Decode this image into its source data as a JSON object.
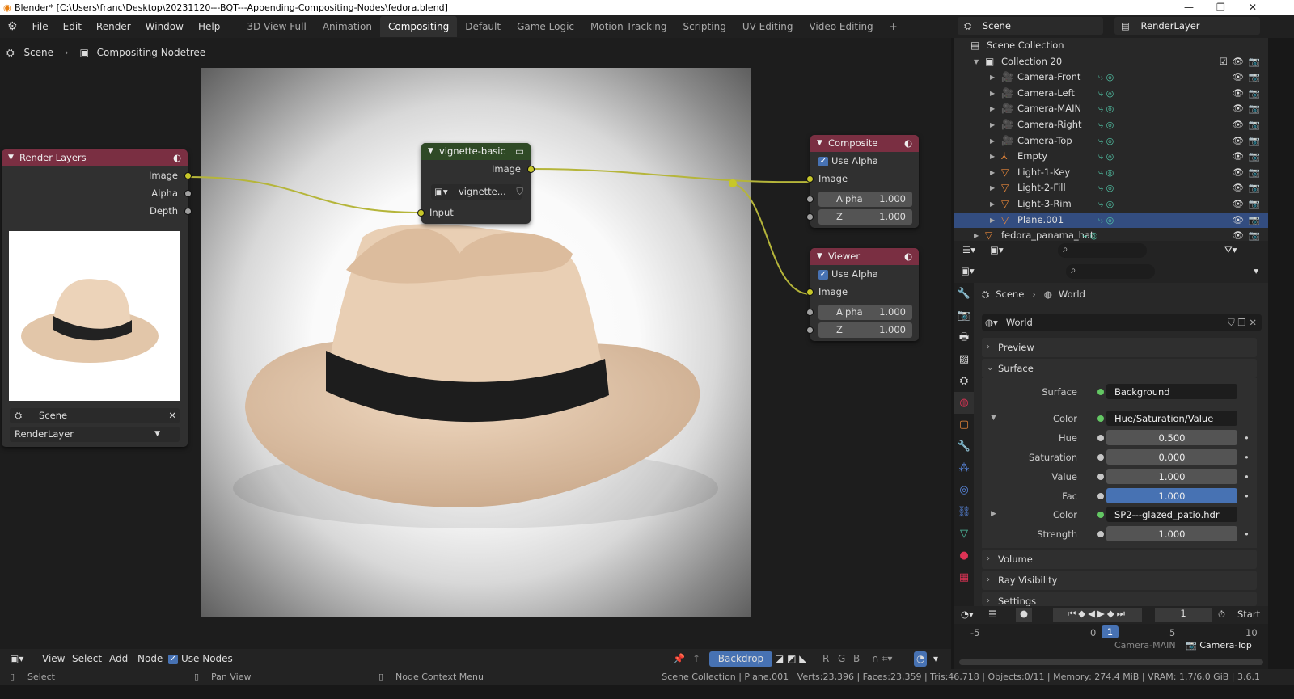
{
  "title": "Blender* [C:\\Users\\franc\\Desktop\\20231120---BQT---Appending-Compositing-Nodes\\fedora.blend]",
  "menu": [
    "File",
    "Edit",
    "Render",
    "Window",
    "Help"
  ],
  "workspaces": [
    "3D View Full",
    "Animation",
    "Compositing",
    "Default",
    "Game Logic",
    "Motion Tracking",
    "Scripting",
    "UV Editing",
    "Video Editing",
    "+"
  ],
  "active_workspace": "Compositing",
  "top_right": {
    "scene": "Scene",
    "view_layer": "RenderLayer"
  },
  "breadcrumb": {
    "scene": "Scene",
    "tree": "Compositing Nodetree"
  },
  "nodes": {
    "render_layers": {
      "title": "Render Layers",
      "outputs": [
        "Image",
        "Alpha",
        "Depth"
      ],
      "scene": "Scene",
      "layer": "RenderLayer",
      "color": "#7a2f42"
    },
    "vignette": {
      "title": "vignette-basic",
      "output": "Image",
      "group": "vignette...",
      "input": "Input",
      "color": "#2f4a26"
    },
    "composite": {
      "title": "Composite",
      "use_alpha": "Use Alpha",
      "image": "Image",
      "alpha_label": "Alpha",
      "alpha": "1.000",
      "z_label": "Z",
      "z": "1.000",
      "color": "#7a2f42"
    },
    "viewer": {
      "title": "Viewer",
      "use_alpha": "Use Alpha",
      "image": "Image",
      "alpha_label": "Alpha",
      "alpha": "1.000",
      "z_label": "Z",
      "z": "1.000",
      "color": "#7a2f42"
    }
  },
  "outliner": {
    "root": "Scene Collection",
    "items": [
      {
        "name": "Collection 20",
        "type": "collection"
      },
      {
        "name": "Camera-Front",
        "type": "camera"
      },
      {
        "name": "Camera-Left",
        "type": "camera"
      },
      {
        "name": "Camera-MAIN",
        "type": "camera"
      },
      {
        "name": "Camera-Right",
        "type": "camera"
      },
      {
        "name": "Camera-Top",
        "type": "camera"
      },
      {
        "name": "Empty",
        "type": "empty"
      },
      {
        "name": "Light-1-Key",
        "type": "light"
      },
      {
        "name": "Light-2-Fill",
        "type": "light"
      },
      {
        "name": "Light-3-Rim",
        "type": "light"
      },
      {
        "name": "Plane.001",
        "type": "mesh",
        "selected": true
      },
      {
        "name": "fedora_panama_hat",
        "type": "mesh"
      }
    ]
  },
  "properties": {
    "breadcrumb": {
      "scene": "Scene",
      "world": "World"
    },
    "world_name": "World",
    "sections": {
      "preview": "Preview",
      "surface": "Surface",
      "volume": "Volume",
      "ray": "Ray Visibility",
      "settings": "Settings"
    },
    "rows": [
      {
        "label": "Surface",
        "value": "Background"
      },
      {
        "label": "Color",
        "value": "Hue/Saturation/Value"
      },
      {
        "label": "Hue",
        "value": "0.500"
      },
      {
        "label": "Saturation",
        "value": "0.000"
      },
      {
        "label": "Value",
        "value": "1.000"
      },
      {
        "label": "Fac",
        "value": "1.000"
      },
      {
        "label": "Color",
        "value": "SP2---glazed_patio.hdr"
      },
      {
        "label": "Strength",
        "value": "1.000"
      }
    ]
  },
  "timeline": {
    "current_frame": "1",
    "start_label": "Start",
    "ticks": [
      "-5",
      "0",
      "5",
      "10"
    ],
    "markers": [
      "Camera-MAIN",
      "Camera-Top"
    ]
  },
  "node_header": {
    "view": "View",
    "select": "Select",
    "add": "Add",
    "node": "Node",
    "use_nodes": "Use Nodes",
    "backdrop": "Backdrop",
    "channels": [
      "R",
      "G",
      "B"
    ]
  },
  "status": {
    "select": "Select",
    "pan": "Pan View",
    "context": "Node Context Menu",
    "info": "Scene Collection | Plane.001 | Verts:23,396 | Faces:23,359 | Tris:46,718 | Objects:0/11 | Memory: 274.4 MiB | VRAM: 1.7/6.0 GiB | 3.6.1"
  },
  "colors": {
    "accent": "#4772b3",
    "socket_image": "#c7c729",
    "wire": "#b5b53a"
  }
}
